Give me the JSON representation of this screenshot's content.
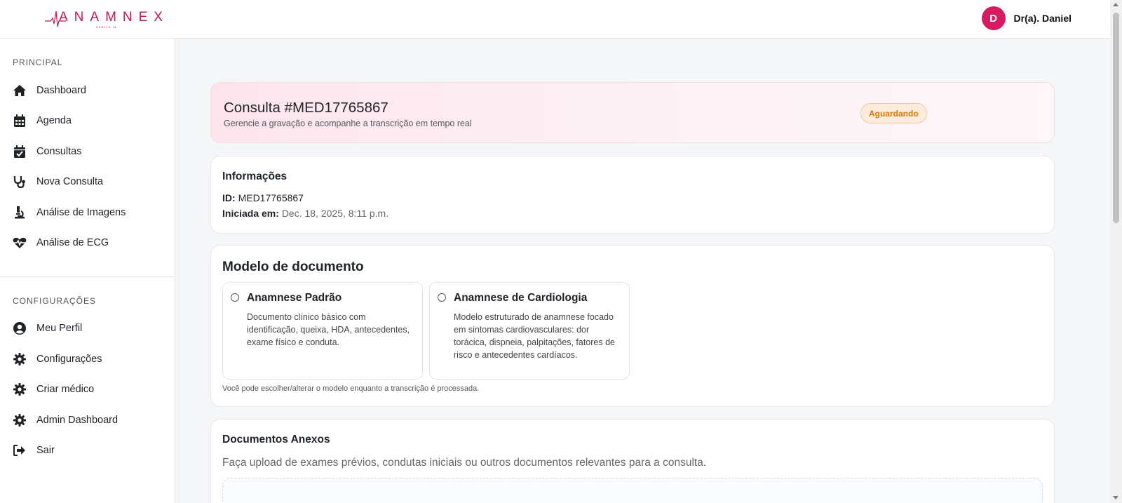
{
  "brand": {
    "logo_text": "ANAMNEX",
    "logo_subtext": "HEALTH IA",
    "accent_color": "#c2185b"
  },
  "user": {
    "initial": "D",
    "name": "Dr(a). Daniel",
    "avatar_color": "#d81b60"
  },
  "sidebar": {
    "principal_title": "PRINCIPAL",
    "principal_items": [
      {
        "label": "Dashboard",
        "icon": "home-icon"
      },
      {
        "label": "Agenda",
        "icon": "calendar-icon"
      },
      {
        "label": "Consultas",
        "icon": "calendar-check-icon"
      },
      {
        "label": "Nova Consulta",
        "icon": "stethoscope-icon"
      },
      {
        "label": "Análise de Imagens",
        "icon": "microscope-icon"
      },
      {
        "label": "Análise de ECG",
        "icon": "heart-pulse-icon"
      }
    ],
    "config_title": "CONFIGURAÇÕES",
    "config_items": [
      {
        "label": "Meu Perfil",
        "icon": "user-circle-icon"
      },
      {
        "label": "Configurações",
        "icon": "gear-icon"
      },
      {
        "label": "Criar médico",
        "icon": "gear-icon"
      },
      {
        "label": "Admin Dashboard",
        "icon": "gear-icon"
      },
      {
        "label": "Sair",
        "icon": "sign-out-icon"
      }
    ]
  },
  "consulta": {
    "title": "Consulta #MED17765867",
    "subtitle": "Gerencie a gravação e acompanhe a transcrição em tempo real",
    "status": "Aguardando",
    "status_color": "#d97706"
  },
  "info": {
    "heading": "Informações",
    "id_label": "ID:",
    "id_value": "MED17765867",
    "started_label": "Iniciada em:",
    "started_value": "Dec. 18, 2025, 8:11 p.m."
  },
  "model": {
    "heading": "Modelo de documento",
    "options": [
      {
        "title": "Anamnese Padrão",
        "description": "Documento clínico básico com identificação, queixa, HDA, antecedentes, exame físico e conduta.",
        "selected": false
      },
      {
        "title": "Anamnese de Cardiologia",
        "description": "Modelo estruturado de anamnese focado em sintomas cardiovasculares: dor torácica, dispneia, palpitações, fatores de risco e antecedentes cardíacos.",
        "selected": false
      }
    ],
    "hint": "Você pode escolher/alterar o modelo enquanto a transcrição é processada."
  },
  "docs": {
    "heading": "Documentos Anexos",
    "subtitle": "Faça upload de exames prévios, condutas iniciais ou outros documentos relevantes para a consulta."
  }
}
